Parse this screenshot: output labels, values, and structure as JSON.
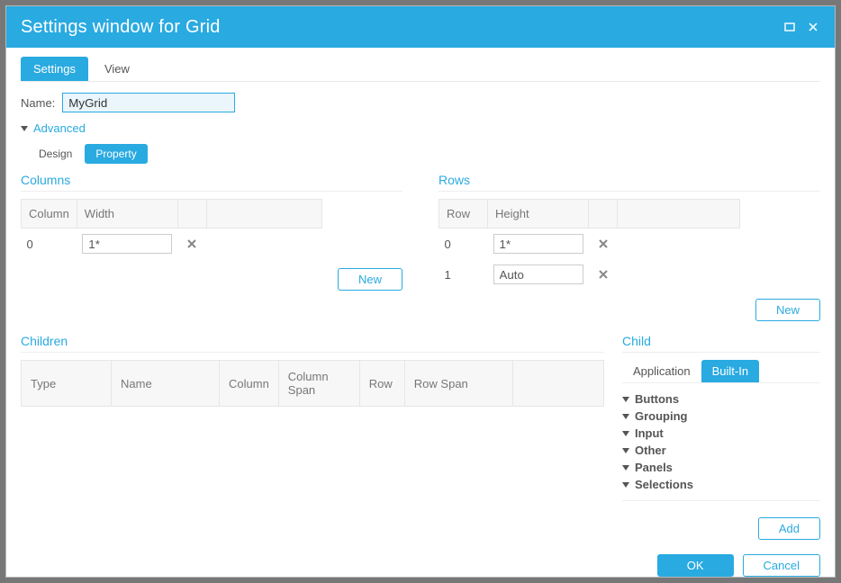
{
  "window": {
    "title": "Settings window for Grid"
  },
  "tabs": {
    "settings": "Settings",
    "view": "View"
  },
  "name_label": "Name:",
  "name_value": "MyGrid",
  "advanced_label": "Advanced",
  "subtabs": {
    "design": "Design",
    "property": "Property"
  },
  "columns": {
    "title": "Columns",
    "headers": {
      "col": "Column",
      "width": "Width"
    },
    "rows": [
      {
        "index": "0",
        "width": "1*"
      }
    ],
    "new_label": "New"
  },
  "rows": {
    "title": "Rows",
    "headers": {
      "row": "Row",
      "height": "Height"
    },
    "rows": [
      {
        "index": "0",
        "height": "1*"
      },
      {
        "index": "1",
        "height": "Auto"
      }
    ],
    "new_label": "New"
  },
  "children": {
    "title": "Children",
    "headers": {
      "type": "Type",
      "name": "Name",
      "column": "Column",
      "colspan": "Column Span",
      "row": "Row",
      "rowspan": "Row Span"
    }
  },
  "child": {
    "title": "Child",
    "tabs": {
      "app": "Application",
      "builtin": "Built-In"
    },
    "categories": [
      "Buttons",
      "Grouping",
      "Input",
      "Other",
      "Panels",
      "Selections"
    ],
    "add_label": "Add"
  },
  "footer": {
    "ok": "OK",
    "cancel": "Cancel"
  }
}
